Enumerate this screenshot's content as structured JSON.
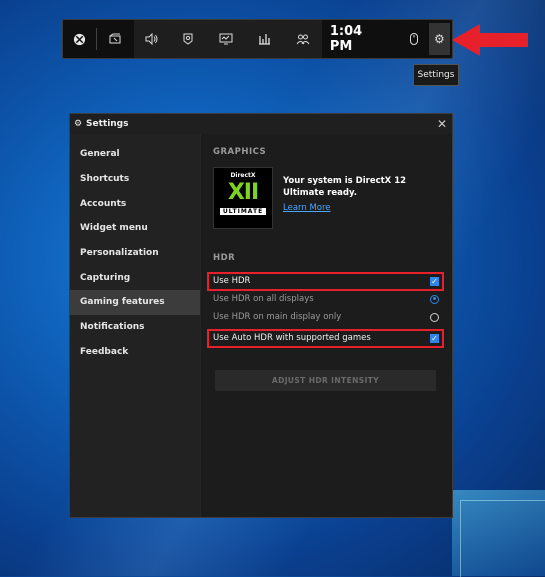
{
  "gamebar": {
    "icons": [
      "xbox-icon",
      "widget-capture-icon",
      "audio-icon",
      "capture-icon",
      "performance-monitor-icon",
      "resources-icon",
      "party-icon",
      "mouse-icon",
      "gear-icon"
    ],
    "time": "1:04 PM",
    "tooltip": "Settings"
  },
  "settings": {
    "title": "Settings",
    "nav": [
      "General",
      "Shortcuts",
      "Accounts",
      "Widget menu",
      "Personalization",
      "Capturing",
      "Gaming features",
      "Notifications",
      "Feedback"
    ],
    "active_nav": "Gaming features",
    "graphics_header": "GRAPHICS",
    "dx_logo_top": "DirectX",
    "dx_logo_mid": "XII",
    "dx_logo_bottom": "ULTIMATE",
    "dx_text": "Your system is DirectX 12 Ultimate ready.",
    "learn_more": "Learn More",
    "hdr_header": "HDR",
    "use_hdr": "Use HDR",
    "hdr_all": "Use HDR on all displays",
    "hdr_main": "Use HDR on main display only",
    "auto_hdr": "Use Auto HDR with supported games",
    "adjust_btn": "ADJUST HDR INTENSITY"
  },
  "colors": {
    "accent": "#2f86e8",
    "highlight": "#e8202a",
    "arrow": "#e8202a"
  }
}
